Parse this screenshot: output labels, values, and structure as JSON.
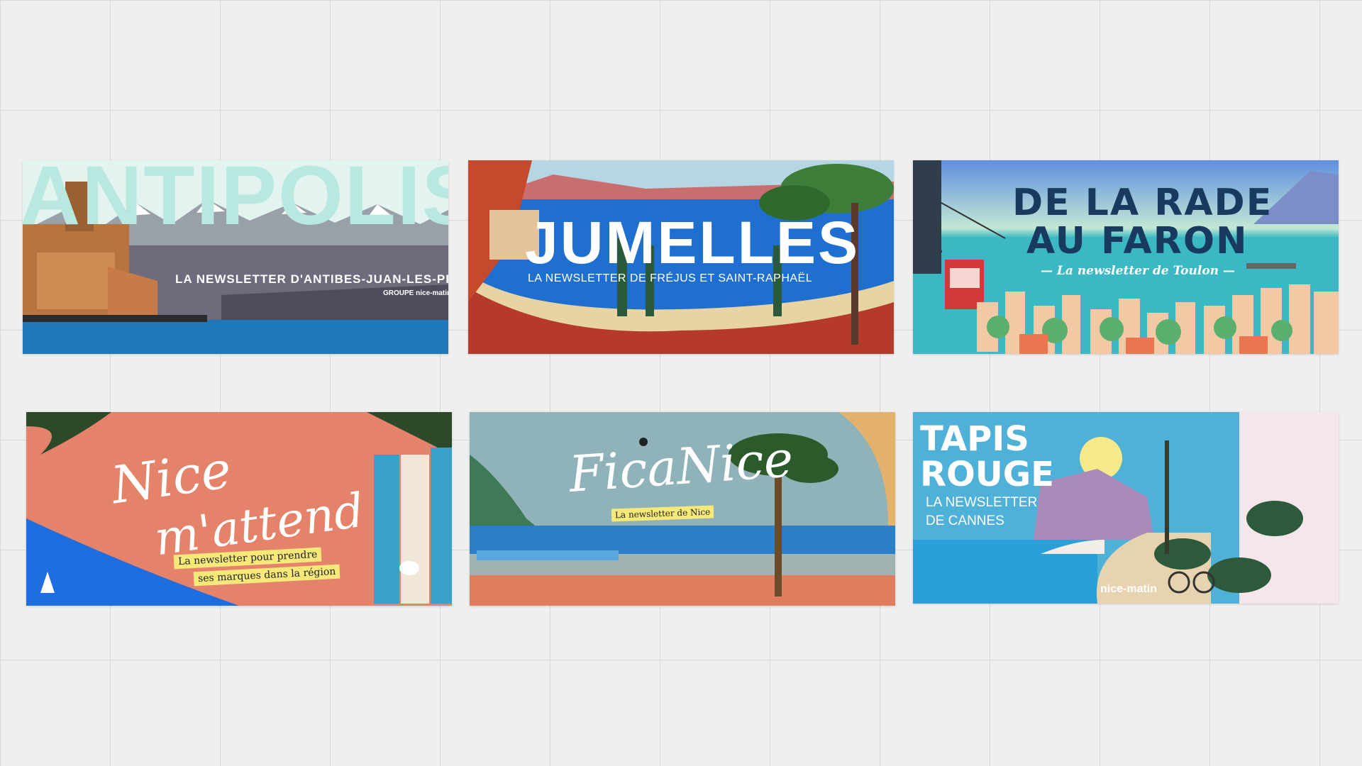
{
  "cards": [
    {
      "title": "ANTIPOLIS",
      "subtitle": "LA NEWSLETTER D'ANTIBES-JUAN-LES-PINS",
      "brand": "GROUPE nice-matin",
      "colors": {
        "sky": "#b9e8e0",
        "sea": "#1f79b8",
        "fort": "#c77b47"
      }
    },
    {
      "title": "JUMELLES",
      "subtitle": "LA NEWSLETTER DE FRÉJUS ET SAINT-RAPHAËL",
      "colors": {
        "sea": "#1f6fd1",
        "earth": "#b63a2b"
      }
    },
    {
      "title_line1": "DE LA RADE",
      "title_line2": "AU FARON",
      "subtitle": "— La newsletter de Toulon —",
      "colors": {
        "sea": "#3cb8c4",
        "title": "#173a5e"
      }
    },
    {
      "title_line1": "Nice",
      "title_line2": "m'attend",
      "tag_line1": "La newsletter pour prendre",
      "tag_line2": "ses marques dans la région",
      "colors": {
        "bg": "#e4826a",
        "sea": "#1e6ee0",
        "shutter": "#3aa0c8"
      }
    },
    {
      "title": "FicaNice",
      "tag": "La newsletter de Nice",
      "colors": {
        "sky": "#8fb3b8",
        "sea": "#2a7fc6",
        "sand": "#e07d5e"
      }
    },
    {
      "title_line1": "TAPIS",
      "title_line2": "ROUGE",
      "subtitle_line1": "LA NEWSLETTER",
      "subtitle_line2": "DE CANNES",
      "brand": "nice-matin",
      "colors": {
        "sky": "#4fb1d8",
        "sun": "#f5e98a",
        "mountain": "#a98ab8"
      }
    }
  ]
}
